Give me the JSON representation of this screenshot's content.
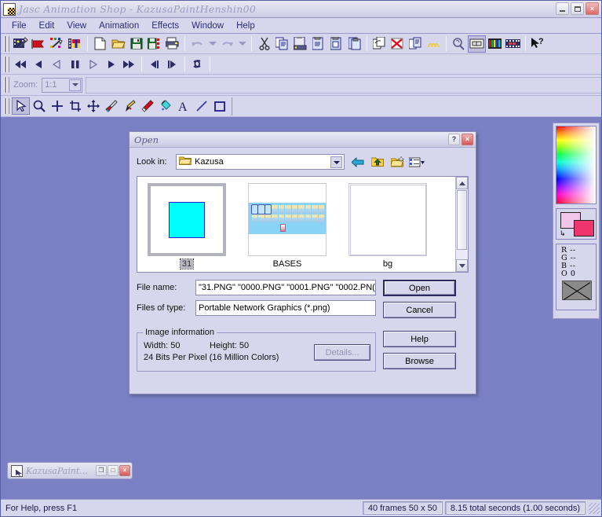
{
  "window": {
    "title": "Jasc Animation Shop - KazusaPaintHenshin00",
    "icon": "app-icon",
    "minimize_label": "",
    "maximize_label": "",
    "close_label": "×"
  },
  "menubar": {
    "items": [
      {
        "label": "File"
      },
      {
        "label": "Edit"
      },
      {
        "label": "View"
      },
      {
        "label": "Animation"
      },
      {
        "label": "Effects"
      },
      {
        "label": "Window"
      },
      {
        "label": "Help"
      }
    ]
  },
  "toolbar_main": {
    "buttons": [
      {
        "name": "animation-wizard-icon"
      },
      {
        "name": "banner-wizard-icon"
      },
      {
        "name": "effects-wizard-icon"
      },
      {
        "name": "color-wizard-icon"
      },
      {
        "name": "new-icon"
      },
      {
        "name": "open-icon"
      },
      {
        "name": "save-icon"
      },
      {
        "name": "save-as-icon"
      },
      {
        "name": "print-icon"
      },
      {
        "name": "undo-icon"
      },
      {
        "name": "undo-dropdown-arrow"
      },
      {
        "name": "redo-icon"
      },
      {
        "name": "redo-dropdown-arrow"
      },
      {
        "name": "cut-icon"
      },
      {
        "name": "copy-icon"
      },
      {
        "name": "paste-icon"
      },
      {
        "name": "paste-as-new-animation-icon"
      },
      {
        "name": "paste-into-selected-frame-icon"
      },
      {
        "name": "paste-before-current-frame-icon"
      },
      {
        "name": "duplicate-selected-frames-icon"
      },
      {
        "name": "delete-frames-icon"
      },
      {
        "name": "propagate-paste-icon"
      },
      {
        "name": "animation-properties-icon"
      },
      {
        "name": "view-animation-icon"
      },
      {
        "name": "frame-properties-icon"
      },
      {
        "name": "onion-skin-icon"
      },
      {
        "name": "filmstrip-icon"
      },
      {
        "name": "help-pointer-icon"
      }
    ]
  },
  "toolbar_playback": {
    "buttons": [
      {
        "name": "rewind-to-start-icon"
      },
      {
        "name": "step-back-icon"
      },
      {
        "name": "play-reverse-icon"
      },
      {
        "name": "pause-icon"
      },
      {
        "name": "play-outline-icon"
      },
      {
        "name": "play-icon"
      },
      {
        "name": "fast-forward-icon"
      },
      {
        "name": "previous-frame-icon"
      },
      {
        "name": "next-frame-icon"
      },
      {
        "name": "loop-icon"
      }
    ]
  },
  "zoombar": {
    "label": "Zoom:",
    "value": "1:1",
    "options": [
      "1:1"
    ]
  },
  "toolsbar": {
    "tools": [
      {
        "name": "arrow-tool-icon",
        "selected": true
      },
      {
        "name": "zoom-tool-icon",
        "selected": false
      },
      {
        "name": "mover-crosshair-tool-icon",
        "selected": false
      },
      {
        "name": "crop-tool-icon",
        "selected": false
      },
      {
        "name": "pan-tool-icon",
        "selected": false
      },
      {
        "name": "dropper-tool-icon",
        "selected": false
      },
      {
        "name": "paint-brush-tool-icon",
        "selected": false
      },
      {
        "name": "eraser-tool-icon",
        "selected": false
      },
      {
        "name": "flood-fill-tool-icon",
        "selected": false
      },
      {
        "name": "text-tool-icon",
        "selected": false
      },
      {
        "name": "line-tool-icon",
        "selected": false
      },
      {
        "name": "shape-tool-icon",
        "selected": false
      }
    ]
  },
  "color_panel": {
    "gradient_name": "color-gradient-picker",
    "foreground_color": "#f2c6ea",
    "background_color": "#f0356e",
    "swap_icon": "swap-colors-icon",
    "readouts": [
      {
        "channel": "R",
        "value": "--"
      },
      {
        "channel": "G",
        "value": "--"
      },
      {
        "channel": "B",
        "value": "--"
      },
      {
        "channel": "O",
        "value": "0"
      }
    ],
    "transparent_swatch": "transparent-swatch"
  },
  "dialog": {
    "title": "Open",
    "help_label": "?",
    "close_label": "×",
    "look_in": {
      "label": "Look in:",
      "value": "Kazusa"
    },
    "nav_buttons": [
      {
        "name": "back-icon"
      },
      {
        "name": "up-one-level-icon"
      },
      {
        "name": "create-new-folder-icon"
      },
      {
        "name": "views-icon"
      }
    ],
    "files": [
      {
        "label": "31",
        "art": "cyan-square",
        "selected": true
      },
      {
        "label": "BASES",
        "art": "sprite-sheet",
        "selected": false
      },
      {
        "label": "bg",
        "art": "blank",
        "selected": false
      }
    ],
    "file_name": {
      "label": "File name:",
      "value": "\"31.PNG\" \"0000.PNG\" \"0001.PNG\" \"0002.PN("
    },
    "files_of_type": {
      "label": "Files of type:",
      "value": "Portable Network Graphics (*.png)"
    },
    "buttons": {
      "open": "Open",
      "cancel": "Cancel",
      "help": "Help",
      "browse": "Browse"
    },
    "image_information": {
      "title": "Image information",
      "width_label": "Width: 50",
      "height_label": "Height: 50",
      "bit_depth": "24 Bits Per Pixel (16 Million Colors)",
      "details_button": "Details..."
    },
    "scrollbar": {
      "up": "scroll-up-icon",
      "down": "scroll-down-icon"
    }
  },
  "mdi_child": {
    "title": "KazusaPaint...",
    "restore_label": "❐",
    "maximize_label": "□",
    "close_label": "×"
  },
  "statusbar": {
    "hint": "For Help, press F1",
    "frames": "40 frames   50 x 50",
    "timing": "8.15 total seconds   (1.00 seconds)"
  }
}
